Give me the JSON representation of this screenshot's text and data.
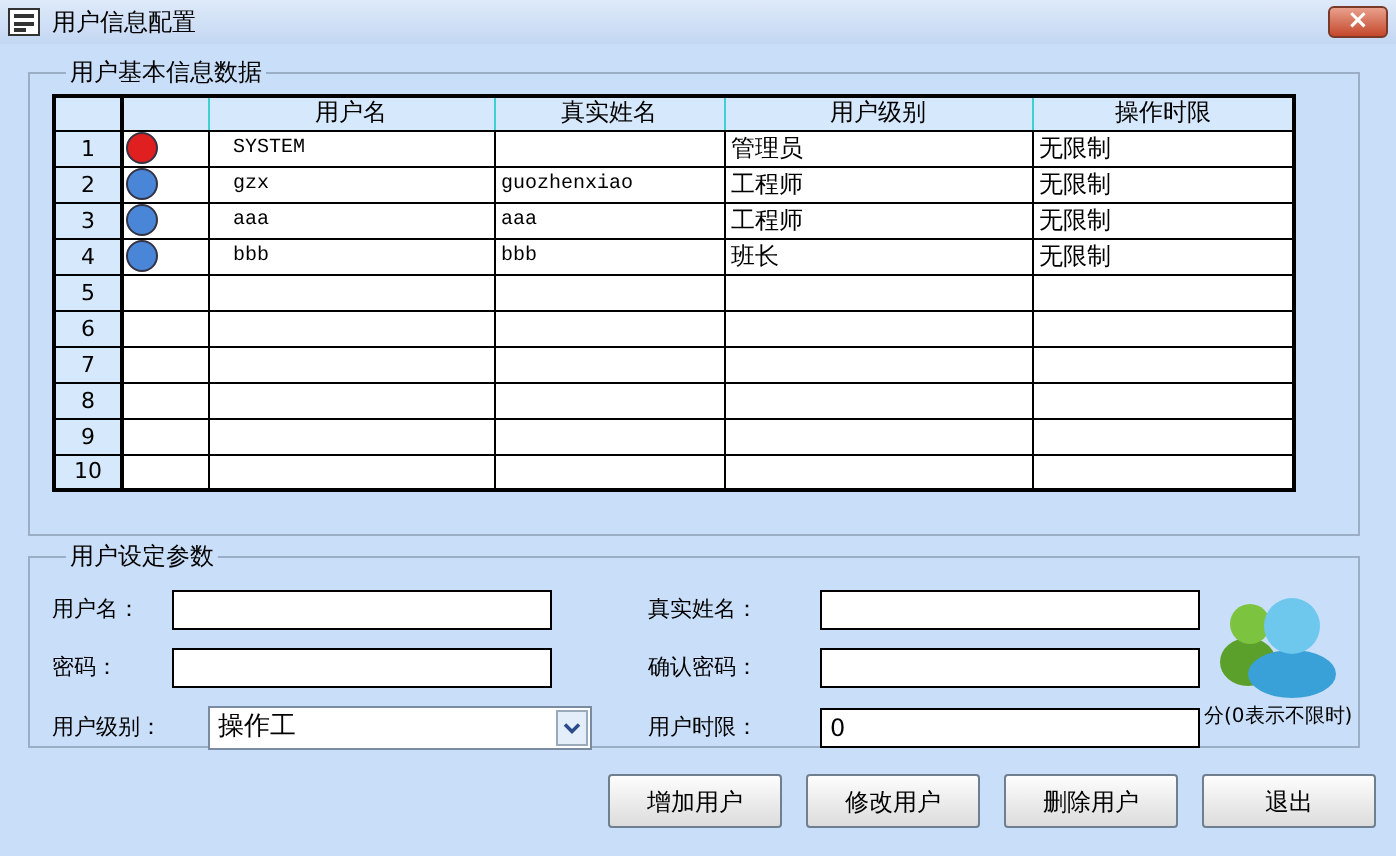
{
  "window": {
    "title": "用户信息配置",
    "close": "×"
  },
  "data_group": {
    "title": "用户基本信息数据",
    "table": {
      "columns": [
        "用户名",
        "真实姓名",
        "用户级别",
        "操作时限"
      ],
      "rows": [
        {
          "number": "1",
          "color": "#e02020",
          "username": "SYSTEM",
          "level": "管理员",
          "time_limit": "无限制"
        },
        {
          "number": "2",
          "color": "#4a86d8",
          "username": "gzx",
          "real_name": "guozhenxiao",
          "level": "工程师",
          "time_limit": "无限制"
        },
        {
          "number": "3",
          "color": "#4a86d8",
          "username": "aaa",
          "real_name": "aaa",
          "level": "工程师",
          "time_limit": "无限制"
        },
        {
          "number": "4",
          "color": "#4a86d8",
          "username": "bbb",
          "real_name": "bbb",
          "level": "班长",
          "time_limit": "无限制"
        },
        {
          "number": "5"
        },
        {
          "number": "6"
        },
        {
          "number": "7"
        },
        {
          "number": "8"
        },
        {
          "number": "9"
        },
        {
          "number": "10"
        }
      ]
    }
  },
  "settings_group": {
    "title": "用户设定参数",
    "fields": [
      {
        "label": "用户名：",
        "kind": "text"
      },
      {
        "label": "真实姓名：",
        "kind": "text"
      },
      {
        "label": "密码：",
        "kind": "text"
      },
      {
        "label": "确认密码：",
        "kind": "text"
      },
      {
        "label": "用户级别：",
        "kind": "select",
        "value": "操作工"
      },
      {
        "label": "用户时限：",
        "kind": "text",
        "value": "0"
      }
    ],
    "note": "分(0表示不限时)"
  },
  "buttons": [
    "增加用户",
    "修改用户",
    "删除用户",
    "退出"
  ]
}
